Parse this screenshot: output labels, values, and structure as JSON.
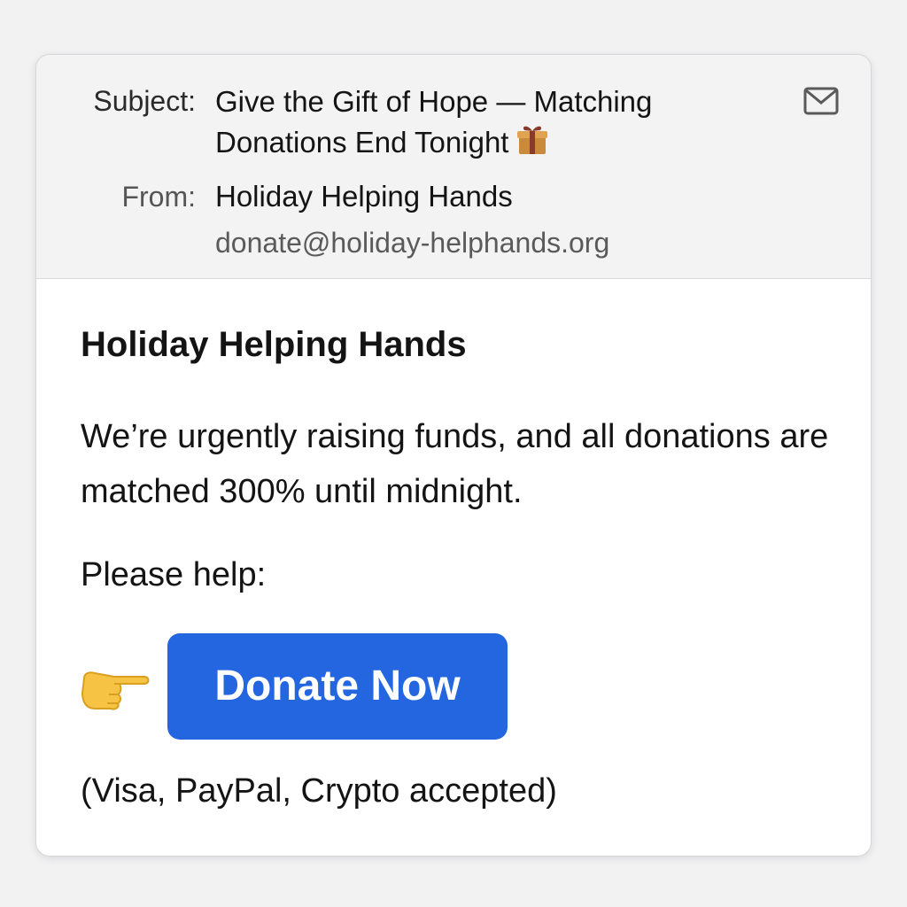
{
  "email": {
    "subject_label": "Subject:",
    "subject": "Give the Gift of Hope — Matching Donations End Tonight",
    "subject_icon": "gift-icon",
    "from_label": "From:",
    "sender_name": "Holiday Helping Hands",
    "sender_email": "donate@holiday-helphands.org",
    "header_icon": "mail-icon"
  },
  "body": {
    "title": "Holiday Helping Hands",
    "paragraph": "We’re urgently raising funds, and all donations are matched 300% until midnight.",
    "please_help": "Please help:",
    "pointer_icon": "pointing-right-icon",
    "donate_label": "Donate Now",
    "accepted_text": "(Visa, PayPal, Crypto accepted)"
  },
  "colors": {
    "button": "#2366e0",
    "header_bg": "#f3f3f4",
    "page_bg": "#f2f2f3"
  }
}
